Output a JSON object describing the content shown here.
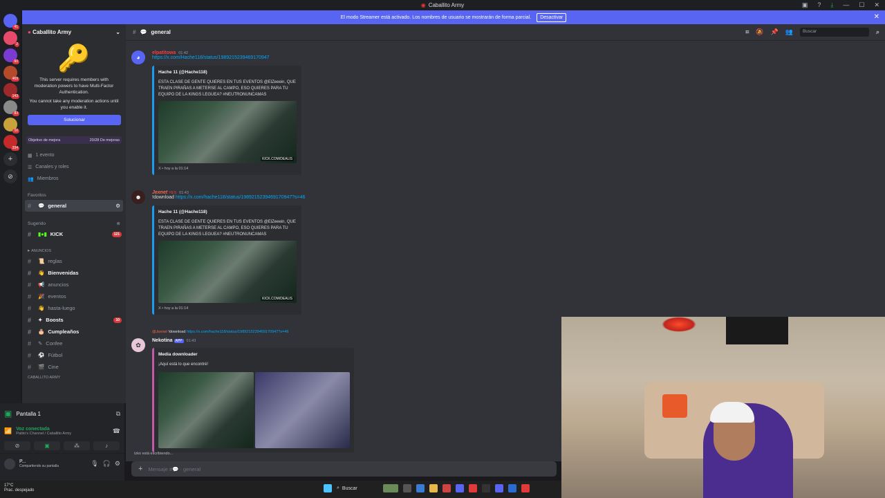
{
  "window": {
    "title": "Caballito Army"
  },
  "streamer_banner": {
    "text": "El modo Streamer está activado. Los nombres de usuario se mostrarán de forma parcial.",
    "button": "Desactivar"
  },
  "guild_badges": [
    "41",
    "2",
    "60",
    "469",
    "143",
    "83",
    "10",
    "334"
  ],
  "server": {
    "name": "Caballito Army",
    "mfa_text_1": "This server requires members with moderation powers to have Multi-Factor Authentication.",
    "mfa_text_2": "You cannot take any moderation actions until you enable it.",
    "solve_button": "Solucionar",
    "goal_label": "Objetivo de mejora",
    "goal_value": "20/28 De mejoras",
    "menu": [
      "1 evento",
      "Canales y roles",
      "Miembros"
    ],
    "favorites_label": "Favoritos",
    "active_channel": "general",
    "suggested_label": "Sugerido",
    "kick_channel": "KICK",
    "kick_badge": "121",
    "anuncios_label": "ANUNCIOS",
    "channels": [
      {
        "name": "reglas",
        "bold": false,
        "badge": ""
      },
      {
        "name": "Bienvenidas",
        "bold": true,
        "badge": ""
      },
      {
        "name": "anuncios",
        "bold": false,
        "badge": ""
      },
      {
        "name": "eventos",
        "bold": false,
        "badge": ""
      },
      {
        "name": "hasta-luego",
        "bold": false,
        "badge": ""
      },
      {
        "name": "Boosts",
        "bold": true,
        "badge": "10"
      },
      {
        "name": "Cumpleaños",
        "bold": true,
        "badge": ""
      },
      {
        "name": "Confee",
        "bold": false,
        "badge": ""
      },
      {
        "name": "Fútbol",
        "bold": false,
        "badge": ""
      },
      {
        "name": "Cine",
        "bold": false,
        "badge": ""
      }
    ],
    "next_section": "CABALLITO ARMY"
  },
  "voice": {
    "screen_label": "Pantalla 1",
    "status": "Voz conectada",
    "channel": "Patito's Channel / Caballito Army",
    "user": "P...",
    "user_status": "Compartiendo su pantalla"
  },
  "chat": {
    "channel": "general",
    "search_placeholder": "Buscar",
    "messages": [
      {
        "author": "elpatitowa",
        "time": "01:42",
        "link": "https://x.com/Hache118/status/1989215239469170947",
        "embed_title": "Hache 11 (@Hache118)",
        "embed_text": "ESTA CLASE DE GENTE QUIERES EN TUS EVENTOS @ElZeeein, QUE TRAEN PIRAÑAS A METERSE AL CAMPO, ESO QUIERES PARA TU EQUIPO DE LA KINGS LEGUEA? #NEUTRONUNCAMAS",
        "embed_footer": "X • hoy a la 01:14",
        "kick": "KICK.COM/DEALIS"
      },
      {
        "author": "Jexnet",
        "tag": "YES",
        "time": "01:43",
        "prefix": "!download",
        "link": "https://x.com/hache118/status/1989215239469170947?s=46",
        "embed_title": "Hache 11 (@Hache118)",
        "embed_text": "ESTA CLASE DE GENTE QUIERES EN TUS EVENTOS @ElZeeein, QUE TRAEN PIRAÑAS A METERSE AL CAMPO, ESO QUIERES PARA TU EQUIPO DE LA KINGS LEGUEA? #NEUTRONUNCAMAS",
        "embed_footer": "X • hoy a la 01:14",
        "kick": "KICK.COM/DEALIS"
      },
      {
        "reply_author": "@Jexnet",
        "reply_text": "!download",
        "reply_link": "https://x.com/hache118/status/1989215239469170947?s=46",
        "author": "Nekotina",
        "app": "APP",
        "time": "01:43",
        "embed_title": "Media downloader",
        "embed_text": "¡Aquí está lo que encontré!"
      }
    ],
    "typing": "Izko está escribiendo...",
    "input_placeholder": "Mensaje #💬 · general"
  },
  "taskbar": {
    "temp": "17°C",
    "weather": "Prac. despejado",
    "search": "Buscar"
  }
}
